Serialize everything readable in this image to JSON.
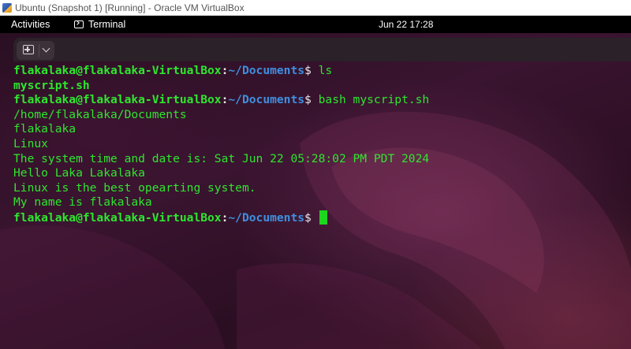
{
  "window": {
    "title": "Ubuntu (Snapshot 1) [Running] - Oracle VM VirtualBox",
    "icon": "virtualbox-icon"
  },
  "top_panel": {
    "activities": "Activities",
    "app_name": "Terminal",
    "app_icon": "terminal-icon",
    "clock": "Jun 22  17:28"
  },
  "terminal": {
    "header": {
      "new_tab_icon": "new-tab-icon",
      "menu_icon": "chevron-down-icon"
    },
    "prompt": {
      "user_host": "flakalaka@flakalaka-VirtualBox",
      "colon": ":",
      "path": "~/Documents",
      "dollar": "$"
    },
    "lines": [
      {
        "type": "prompt",
        "command": " ls"
      },
      {
        "type": "output",
        "text": "myscript.sh",
        "bold": true
      },
      {
        "type": "prompt",
        "command": " bash myscript.sh"
      },
      {
        "type": "output",
        "text": "/home/flakalaka/Documents"
      },
      {
        "type": "output",
        "text": "flakalaka"
      },
      {
        "type": "output",
        "text": "Linux"
      },
      {
        "type": "output",
        "text": "The system time and date is: Sat Jun 22 05:28:02 PM PDT 2024"
      },
      {
        "type": "output",
        "text": "Hello Laka Lakalaka"
      },
      {
        "type": "output",
        "text": "Linux is the best opearting system."
      },
      {
        "type": "output",
        "text": "My name is flakalaka"
      },
      {
        "type": "prompt",
        "command": " ",
        "cursor": true
      }
    ]
  },
  "colors": {
    "terminal_text": "#2ee62e",
    "path": "#3f8fe0",
    "panel_bg": "#000000",
    "cursor": "#1ed61e"
  }
}
